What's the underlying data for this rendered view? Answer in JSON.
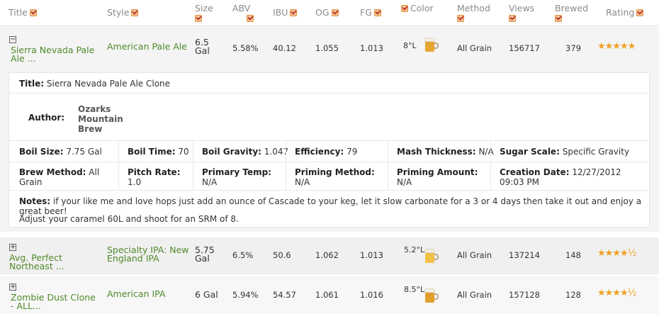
{
  "headers": {
    "title": "Title",
    "style": "Style",
    "size": "Size",
    "abv": "ABV",
    "ibu": "IBU",
    "og": "OG",
    "fg": "FG",
    "color": "Color",
    "method": "Method",
    "views": "Views",
    "brewed": "Brewed",
    "rating": "Rating"
  },
  "rows": [
    {
      "toggle": "−",
      "title": "Sierra Nevada Pale Ale ...",
      "style": "American Pale Ale",
      "size": "6.5 Gal",
      "abv": "5.58%",
      "ibu": "40.12",
      "og": "1.055",
      "fg": "1.013",
      "color": "8°L",
      "method": "All Grain",
      "views": "156717",
      "brewed": "379",
      "rating": "★★★★★",
      "mug_color": "#e6a530"
    },
    {
      "toggle": "+",
      "title": "Avg. Perfect Northeast ...",
      "style": "Specialty IPA: New England IPA",
      "size": "5.75 Gal",
      "abv": "6.5%",
      "ibu": "50.6",
      "og": "1.062",
      "fg": "1.013",
      "color": "5.2°L",
      "method": "All Grain",
      "views": "137214",
      "brewed": "148",
      "rating": "★★★★½",
      "mug_color": "#f0c048"
    },
    {
      "toggle": "+",
      "title": "Zombie Dust Clone - ALL...",
      "style": "American IPA",
      "size": "6 Gal",
      "abv": "5.94%",
      "ibu": "54.57",
      "og": "1.061",
      "fg": "1.016",
      "color": "8.5°L",
      "method": "All Grain",
      "views": "157128",
      "brewed": "128",
      "rating": "★★★★½",
      "mug_color": "#e29e2c"
    }
  ],
  "detail": {
    "title_label": "Title:",
    "title_value": "Sierra Nevada Pale Ale Clone",
    "author_label": "Author:",
    "author_value": "Ozarks Mountain Brew",
    "boil_size_label": "Boil Size:",
    "boil_size_value": "7.75 Gal",
    "boil_time_label": "Boil Time:",
    "boil_time_value": "70",
    "boil_gravity_label": "Boil Gravity:",
    "boil_gravity_value": "1.047",
    "efficiency_label": "Efficiency:",
    "efficiency_value": "79",
    "mash_label": "Mash Thickness:",
    "mash_value": "N/A",
    "sugar_label": "Sugar Scale:",
    "sugar_value": "Specific Gravity",
    "brew_method_label": "Brew Method:",
    "brew_method_value": "All Grain",
    "pitch_label": "Pitch Rate:",
    "pitch_value": "1.0",
    "primary_label": "Primary Temp:",
    "primary_value": "N/A",
    "priming_method_label": "Priming Method:",
    "priming_method_value": "N/A",
    "priming_amount_label": "Priming Amount:",
    "priming_amount_value": "N/A",
    "creation_label": "Creation Date:",
    "creation_value": "12/27/2012 09:03 PM",
    "notes_label": "Notes:",
    "notes_value": "if your like me and love hops just add an ounce of Cascade to your keg, let it slow carbonate for a 3 or 4 days then take it out and enjoy a great beer!",
    "notes_line2": "Adjust your caramel 60L and shoot for an SRM of 8."
  }
}
